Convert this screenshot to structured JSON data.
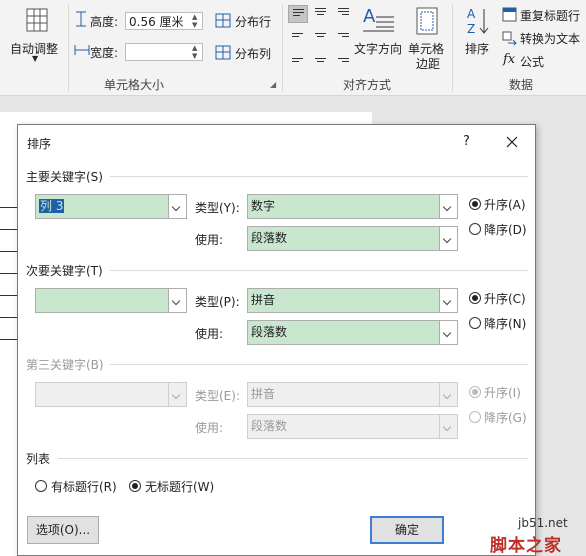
{
  "ribbon": {
    "autofit": {
      "label": "自动调整"
    },
    "height": {
      "label": "高度:",
      "value": "0.56 厘米"
    },
    "width": {
      "label": "宽度:",
      "value": ""
    },
    "distribute_rows": "分布行",
    "distribute_cols": "分布列",
    "group_cell_size": "单元格大小",
    "text_direction": "文字方向",
    "cell_margins": "单元格\n边距",
    "group_alignment": "对齐方式",
    "sort": "排序",
    "repeat_header": "重复标题行",
    "convert_to_text": "转换为文本",
    "formula": "公式",
    "group_data": "数据"
  },
  "dialog": {
    "title": "排序",
    "help": "?",
    "primary": {
      "heading": "主要关键字(S)",
      "key": "列 3",
      "type_label": "类型(Y):",
      "type_value": "数字",
      "use_label": "使用:",
      "use_value": "段落数",
      "asc": "升序(A)",
      "desc": "降序(D)"
    },
    "secondary": {
      "heading": "次要关键字(T)",
      "key": "",
      "type_label": "类型(P):",
      "type_value": "拼音",
      "use_label": "使用:",
      "use_value": "段落数",
      "asc": "升序(C)",
      "desc": "降序(N)"
    },
    "tertiary": {
      "heading": "第三关键字(B)",
      "key": "",
      "type_label": "类型(E):",
      "type_value": "拼音",
      "use_label": "使用:",
      "use_value": "段落数",
      "asc": "升序(I)",
      "desc": "降序(G)"
    },
    "list": {
      "heading": "列表",
      "has_header": "有标题行(R)",
      "no_header": "无标题行(W)"
    },
    "options_button": "选项(O)...",
    "ok_button": "确定"
  },
  "watermark": {
    "site": "jb51.net",
    "name": "脚本之家"
  },
  "colors": {
    "selected_field": "#c9e7cf",
    "accent": "#3c7fd1",
    "watermark": "#c0302a"
  }
}
